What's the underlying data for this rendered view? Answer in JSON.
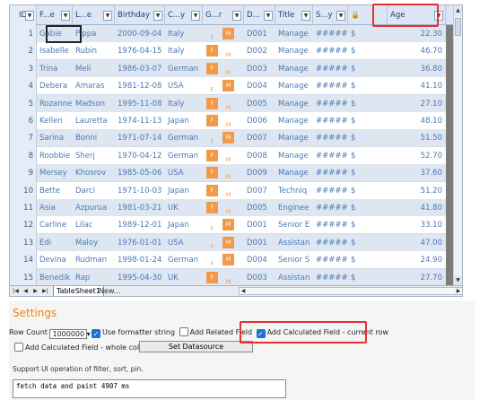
{
  "columns": [
    {
      "label": "ID",
      "filter": true
    },
    {
      "label": "F...e",
      "filter": true
    },
    {
      "label": "L...e",
      "filter": true
    },
    {
      "label": "Birthday",
      "filter": true
    },
    {
      "label": "C...y",
      "filter": true
    },
    {
      "label": "G...r",
      "filter": true
    },
    {
      "label": "D...",
      "filter": true
    },
    {
      "label": "Title",
      "filter": true
    },
    {
      "label": "S...y",
      "filter": true
    },
    {
      "label": "",
      "icon": "lock-icon"
    },
    {
      "label": "Age",
      "filter": true
    }
  ],
  "rows": [
    {
      "id": "1",
      "first": "Gabie",
      "last": "Pippa",
      "birthday": "2000-09-04",
      "country": "Italy",
      "sex": "M",
      "dept": "D001",
      "title": "Manage",
      "salary": "######",
      "currency": "$",
      "age": "22.30"
    },
    {
      "id": "2",
      "first": "Isabelle",
      "last": "Rubin",
      "birthday": "1976-04-15",
      "country": "Italy",
      "sex": "F",
      "dept": "D002",
      "title": "Manage",
      "salary": "######",
      "currency": "$",
      "age": "46.70"
    },
    {
      "id": "3",
      "first": "Trina",
      "last": "Meli",
      "birthday": "1986-03-07",
      "country": "German",
      "sex": "F",
      "dept": "D003",
      "title": "Manage",
      "salary": "######",
      "currency": "$",
      "age": "36.80"
    },
    {
      "id": "4",
      "first": "Debera",
      "last": "Amaras",
      "birthday": "1981-12-08",
      "country": "USA",
      "sex": "M",
      "dept": "D004",
      "title": "Manage",
      "salary": "######",
      "currency": "$",
      "age": "41.10"
    },
    {
      "id": "5",
      "first": "Rozanne",
      "last": "Madson",
      "birthday": "1995-11-08",
      "country": "Italy",
      "sex": "F",
      "dept": "D005",
      "title": "Manage",
      "salary": "######",
      "currency": "$",
      "age": "27.10"
    },
    {
      "id": "6",
      "first": "Kellen",
      "last": "Lauretta",
      "birthday": "1974-11-13",
      "country": "Japan",
      "sex": "F",
      "dept": "D006",
      "title": "Manage",
      "salary": "######",
      "currency": "$",
      "age": "48.10"
    },
    {
      "id": "7",
      "first": "Sarina",
      "last": "Bonni",
      "birthday": "1971-07-14",
      "country": "German",
      "sex": "M",
      "dept": "D007",
      "title": "Manage",
      "salary": "######",
      "currency": "$",
      "age": "51.50"
    },
    {
      "id": "8",
      "first": "Roobbie",
      "last": "Sherj",
      "birthday": "1970-04-12",
      "country": "German",
      "sex": "F",
      "dept": "D008",
      "title": "Manage",
      "salary": "######",
      "currency": "$",
      "age": "52.70"
    },
    {
      "id": "9",
      "first": "Mersey",
      "last": "Khosrov",
      "birthday": "1985-05-06",
      "country": "USA",
      "sex": "F",
      "dept": "D009",
      "title": "Manage",
      "salary": "######",
      "currency": "$",
      "age": "37.60"
    },
    {
      "id": "10",
      "first": "Bette",
      "last": "Darci",
      "birthday": "1971-10-03",
      "country": "Japan",
      "sex": "F",
      "dept": "D007",
      "title": "Techniq",
      "salary": "######",
      "currency": "$",
      "age": "51.20"
    },
    {
      "id": "11",
      "first": "Asia",
      "last": "Azpurua",
      "birthday": "1981-03-21",
      "country": "UK",
      "sex": "F",
      "dept": "D005",
      "title": "Enginee",
      "salary": "######",
      "currency": "$",
      "age": "41.80"
    },
    {
      "id": "12",
      "first": "Carline",
      "last": "Lilac",
      "birthday": "1989-12-01",
      "country": "Japan",
      "sex": "M",
      "dept": "D001",
      "title": "Senior E",
      "salary": "######",
      "currency": "$",
      "age": "33.10"
    },
    {
      "id": "13",
      "first": "Edi",
      "last": "Maloy",
      "birthday": "1976-01-01",
      "country": "USA",
      "sex": "M",
      "dept": "D001",
      "title": "Assistan",
      "salary": "######",
      "currency": "$",
      "age": "47.00"
    },
    {
      "id": "14",
      "first": "Devina",
      "last": "Rudman",
      "birthday": "1998-01-24",
      "country": "German",
      "sex": "M",
      "dept": "D004",
      "title": "Senior S",
      "salary": "######",
      "currency": "$",
      "age": "24.90"
    },
    {
      "id": "15",
      "first": "Benedik",
      "last": "Rap",
      "birthday": "1995-04-30",
      "country": "UK",
      "sex": "F",
      "dept": "D003",
      "title": "Assistan",
      "salary": "######",
      "currency": "$",
      "age": "27.70"
    }
  ],
  "sex_glyphs": {
    "M": "M",
    "F": "F"
  },
  "tabs": {
    "active": "TableSheet1",
    "new": "New..."
  },
  "settings": {
    "title": "Settings",
    "row_count_label": "Row Count",
    "row_count_value": "1000000",
    "use_formatter_label": "Use formatter string",
    "use_formatter_checked": true,
    "add_related_label": "Add Related Field",
    "add_related_checked": false,
    "add_calc_current_label": "Add Calculated Field - current row",
    "add_calc_current_checked": true,
    "add_calc_whole_label": "Add Calculated Field - whole column",
    "add_calc_whole_checked": false,
    "set_datasource_label": "Set Datasource",
    "support_text": "Support UI operation of filter, sort, pin.",
    "output_text": "fetch data and paint 4907 ms"
  },
  "colors": {
    "accent": "#f0820f",
    "highlight": "#e8302e",
    "badge": "#f29a4a",
    "header": "#dce6f4"
  }
}
